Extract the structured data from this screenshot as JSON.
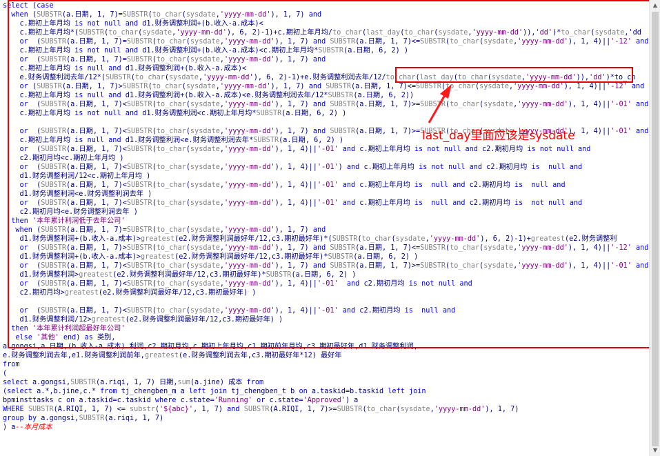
{
  "editor": {
    "lines": [
      {
        "text": "select (case"
      },
      {
        "text": "  when (SUBSTR(a.日期, 1, 7)=SUBSTR(to_char(sysdate,'yyyy-mm-dd'), 1, 7) and"
      },
      {
        "text": "    c.期初上年月均 is not null and d1.财务调整利润+(b.收入-a.成本)<"
      },
      {
        "text": "    c.期初上年月均*(SUBSTR(to_char(sysdate,'yyyy-mm-dd'), 6, 2)-1)+c.期初上年月均/to_char(last_day(to_char(sysdate,'yyyy-mm-dd')),'dd')*to_char(sysdate,'dd"
      },
      {
        "text": "    or  (SUBSTR(a.日期, 1, 7)=SUBSTR(to_char(sysdate,'yyyy-mm-dd'), 1, 7) and SUBSTR(a.日期, 1, 7)<=SUBSTR(to_char(sysdate,'yyyy-mm-dd'), 1, 4)||'-12' and"
      },
      {
        "text": "    c.期初上年月均 is not null and d1.财务调整利润+(b.收入-a.成本)<c.期初上年月均*SUBSTR(a.日期, 6, 2) )"
      },
      {
        "text": "    or  (SUBSTR(a.日期, 1, 7)=SUBSTR(to_char(sysdate,'yyyy-mm-dd'), 1, 7) and"
      },
      {
        "text": "    c.期初上年月均 is null and d1.财务调整利润+(b.收入-a.成本)<"
      },
      {
        "text": "    e.财务调整利润去年/12*(SUBSTR(to_char(sysdate,'yyyy-mm-dd'), 6, 2)-1)+e.财务调整利润去年/12/to_char(last_day(to_char(sysdate,'yyyy-mm-dd')),'dd')*to_ch"
      },
      {
        "text": "    or (SUBSTR(a.日期, 1, 7)>SUBSTR(to_char(sysdate,'yyyy-mm-dd'), 1, 7) and SUBSTR(a.日期, 1, 7)<=SUBSTR(to_char(sysdate,'yyyy-mm-dd'), 1, 4)||'-12' and"
      },
      {
        "text": "    c.期初上年月均 is null and d1.财务调整利润+(b.收入-a.成本)<e.财务调整利润去年/12*SUBSTR(a.日期, 6, 2))"
      },
      {
        "text": "    or  (SUBSTR(a.日期, 1, 7)<SUBSTR(to_char(sysdate,'yyyy-mm-dd'), 1, 7) and SUBSTR(a.日期, 1, 7)>=SUBSTR(to_char(sysdate,'yyyy-mm-dd'), 1, 4)||'-01' and"
      },
      {
        "text": "    c.期初上年月均 is not null and d1.财务调整利润<c.期初上年月均*SUBSTR(a.日期, 6, 2) )"
      },
      {
        "text": ""
      },
      {
        "text": "    or  (SUBSTR(a.日期, 1, 7)<SUBSTR(to_char(sysdate,'yyyy-mm-dd'), 1, 7) and SUBSTR(a.日期, 1, 7)>=SUBSTR(to_char(sysdate,'yyyy-mm-dd'), 1, 4)||'-01' and"
      },
      {
        "text": "    c.期初上年月均 is null and d1.财务调整利润<e.财务调整利润去年*SUBSTR(a.日期, 6, 2) )"
      },
      {
        "text": "    or  (SUBSTR(a.日期, 1, 7)<SUBSTR(to_char(sysdate,'yyyy-mm-dd'), 1, 4)||'-01' and c.期初上年月均 is not null and c2.期初月均 is not null and"
      },
      {
        "text": "    c2.期初月均<c.期初上年月均 )"
      },
      {
        "text": "    or  (SUBSTR(a.日期, 1, 7)<SUBSTR(to_char(sysdate,'yyyy-mm-dd'), 1, 4)||'-01') and c.期初上年月均 is not null and c2.期初月均 is  null and"
      },
      {
        "text": "    d1.财务调整利润/12<c.期初上年月均 )"
      },
      {
        "text": "    or  (SUBSTR(a.日期, 1, 7)<SUBSTR(to_char(sysdate,'yyyy-mm-dd'), 1, 4)||'-01' and c.期初上年月均 is  null and c2.期初月均 is  null and"
      },
      {
        "text": "    d1.财务调整利润<e.财务调整利润去年 )"
      },
      {
        "text": "    or  (SUBSTR(a.日期, 1, 7)<SUBSTR(to_char(sysdate,'yyyy-mm-dd'), 1, 4)||'-01' and c.期初上年月均 is  null and c2.期初月均 is  not null and"
      },
      {
        "text": "    c2.期初月均<e.财务调整利润去年 )"
      },
      {
        "text": "  then '本年累计利润低于去年公司'"
      },
      {
        "text": "   when (SUBSTR(a.日期, 1, 7)=SUBSTR(to_char(sysdate,'yyyy-mm-dd'), 1, 7) and"
      },
      {
        "text": "    d1.财务调整利润+(b.收入-a.成本)>greatest(e2.财务调整利润最好年/12,c3.期初最好年)*(SUBSTR(to_char(sysdate,'yyyy-mm-dd'), 6, 2)-1)+greatest(e2.财务调整利"
      },
      {
        "text": "    or  (SUBSTR(a.日期, 1, 7)>SUBSTR(to_char(sysdate,'yyyy-mm-dd'), 1, 7) and SUBSTR(a.日期, 1, 7)<=SUBSTR(to_char(sysdate,'yyyy-mm-dd'), 1, 4)||'-12' and"
      },
      {
        "text": "    d1.财务调整利润+(b.收入-a.成本)>greatest(e2.财务调整利润最好年/12,c3.期初最好年)*SUBSTR(a.日期, 6, 2) )"
      },
      {
        "text": "    or  (SUBSTR(a.日期, 1, 7)<SUBSTR(to_char(sysdate,'yyyy-mm-dd'), 1, 7) and SUBSTR(a.日期, 1, 7)>=SUBSTR(to_char(sysdate,'yyyy-mm-dd'), 1, 4)||'-01' and"
      },
      {
        "text": "    d1.财务调整利润>greatest(e2.财务调整利润最好年/12,c3.期初最好年)*SUBSTR(a.日期, 6, 2) )"
      },
      {
        "text": "    or  (SUBSTR(a.日期, 1, 7)<SUBSTR(to_char(sysdate,'yyyy-mm-dd'), 1, 4)||'-01'  and c2.期初月均 is not null and"
      },
      {
        "text": "    c2.期初月均>greatest(e2.财务调整利润最好年/12,c3.期初最好年) )"
      },
      {
        "text": ""
      },
      {
        "text": "    or  (SUBSTR(a.日期, 1, 7)<SUBSTR(to_char(sysdate,'yyyy-mm-dd'), 1, 4)||'-01' and c2.期初月均 is  null and"
      },
      {
        "text": "    d1.财务调整利润/12>greatest(e2.财务调整利润最好年/12,c3.期初最好年) )"
      },
      {
        "text": "  then '本年累计利润超最好年公司'"
      },
      {
        "text": "   else '其他' end) as 类别,"
      },
      {
        "text": "a.gongsi,a.日期,(b.收入-a.成本) 利润,c2.期初月均,c.期初上年月均,c1.期初前年月均,c3.期初最好年,d1.财务调整利润,"
      },
      {
        "text": "e.财务调整利润去年,e1.财务调整利润前年,greatest(e.财务调整利润去年,c3.期初最好年*12) 最好年"
      },
      {
        "text": "from"
      },
      {
        "text": "("
      },
      {
        "text": "select a.gongsi,SUBSTR(a.riqi, 1, 7) 日期,sum(a.jine) 成本 from"
      },
      {
        "text": "(select a.*,b.jine,c.* from tj_chengben_m a left join tj_chengben_t b on a.taskid=b.taskid left join"
      },
      {
        "text": "bpminsttasks c on a.taskid=c.taskid where c.state='Running' or c.state='Approved') a"
      },
      {
        "text": "WHERE SUBSTR(A.RIQI, 1, 7) <= substr('${abc}', 1, 7) and SUBSTR(A.RIQI, 1, 7)>=SUBSTR(to_char(sysdate,'yyyy-mm-dd'), 1, 7)"
      },
      {
        "text": "group by a.gongsi,SUBSTR(a.riqi, 1, 7)"
      },
      {
        "text": ") a--本月成本"
      }
    ]
  },
  "annotation": {
    "text": "last_day里面应该是sysdate",
    "color": "#ff0000"
  },
  "colors": {
    "keyword": "#0000ff",
    "string": "#800080",
    "comment": "#ff0000",
    "identifier": "#000080",
    "highlight_box": "#e60000"
  },
  "scrollbar": {
    "up_icon": "scroll-up-arrow-icon",
    "down_icon": "scroll-down-arrow-icon"
  }
}
